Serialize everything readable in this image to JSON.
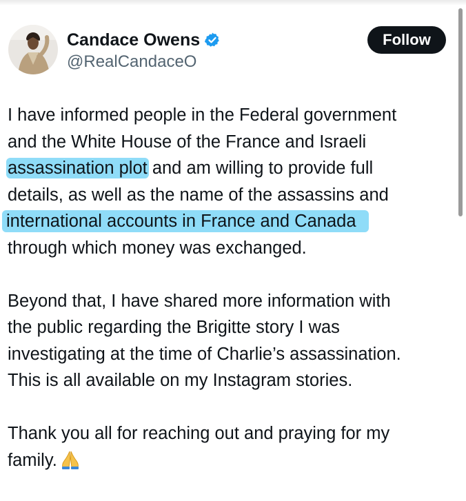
{
  "author": {
    "display_name": "Candace Owens",
    "handle": "@RealCandaceO",
    "verified": true,
    "avatar_icon": "profile-photo"
  },
  "follow_button": {
    "label": "Follow"
  },
  "tweet": {
    "lines": [
      "I have informed people in the Federal government",
      "and the White House of the France and Israeli",
      "and am willing to provide full",
      "details, as well as the name of the assassins and",
      "international accounts in France and Canada",
      "through which money was exchanged.",
      "Beyond that, I have shared more information with",
      "the public regarding the Brigitte story I was",
      "investigating at the time of Charlie’s assassination.",
      "This is all available on my Instagram stories.",
      "Thank you all for reaching out and praying for my",
      "family."
    ],
    "highlighted_phrase": "assassination plot",
    "emoji_icon": "praying-hands-icon"
  },
  "colors": {
    "highlight": "#8fdcf8",
    "follow_button_bg": "#0f1419",
    "verified_badge": "#1d9bf0",
    "handle_text": "#536471"
  }
}
